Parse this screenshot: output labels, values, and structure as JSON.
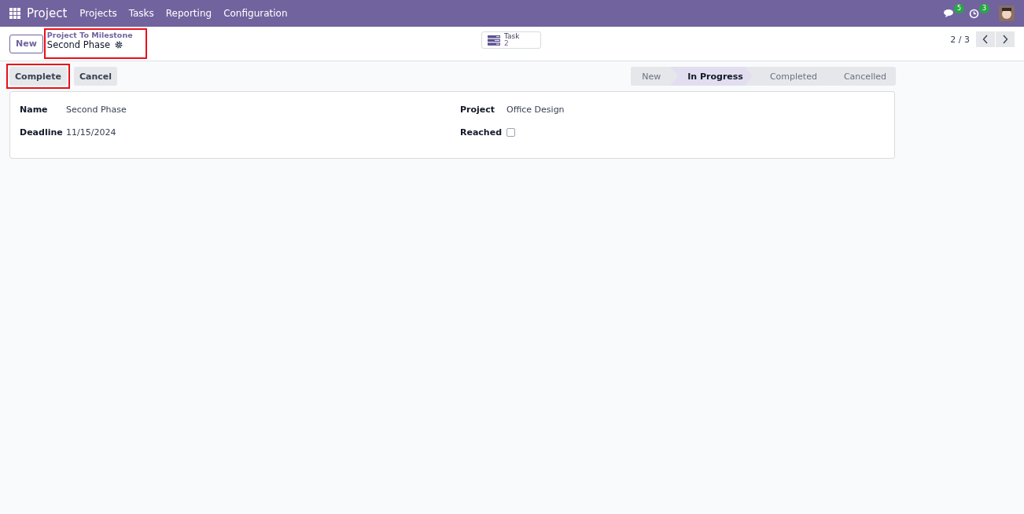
{
  "navbar": {
    "app_name": "Project",
    "menu": [
      "Projects",
      "Tasks",
      "Reporting",
      "Configuration"
    ],
    "messages_count": "5",
    "activities_count": "3"
  },
  "control_panel": {
    "new_button": "New",
    "breadcrumb": {
      "parent": "Project To Milestone",
      "current": "Second Phase",
      "highlighted": true
    },
    "smart_button": {
      "label": "Task",
      "count": "2"
    },
    "pager": "2 / 3"
  },
  "status_bar": {
    "buttons": [
      {
        "label": "Complete",
        "highlighted": true
      },
      {
        "label": "Cancel",
        "highlighted": false
      }
    ],
    "stages": [
      {
        "label": "New",
        "selected": false
      },
      {
        "label": "In Progress",
        "selected": true
      },
      {
        "label": "Completed",
        "selected": false
      },
      {
        "label": "Cancelled",
        "selected": false
      }
    ]
  },
  "form": {
    "left": [
      {
        "label": "Name",
        "value": "Second Phase"
      },
      {
        "label": "Deadline",
        "value": "11/15/2024"
      }
    ],
    "right": [
      {
        "kind": "text",
        "label": "Project",
        "value": "Office Design"
      },
      {
        "kind": "checkbox",
        "label": "Reached",
        "checked": false
      }
    ]
  }
}
